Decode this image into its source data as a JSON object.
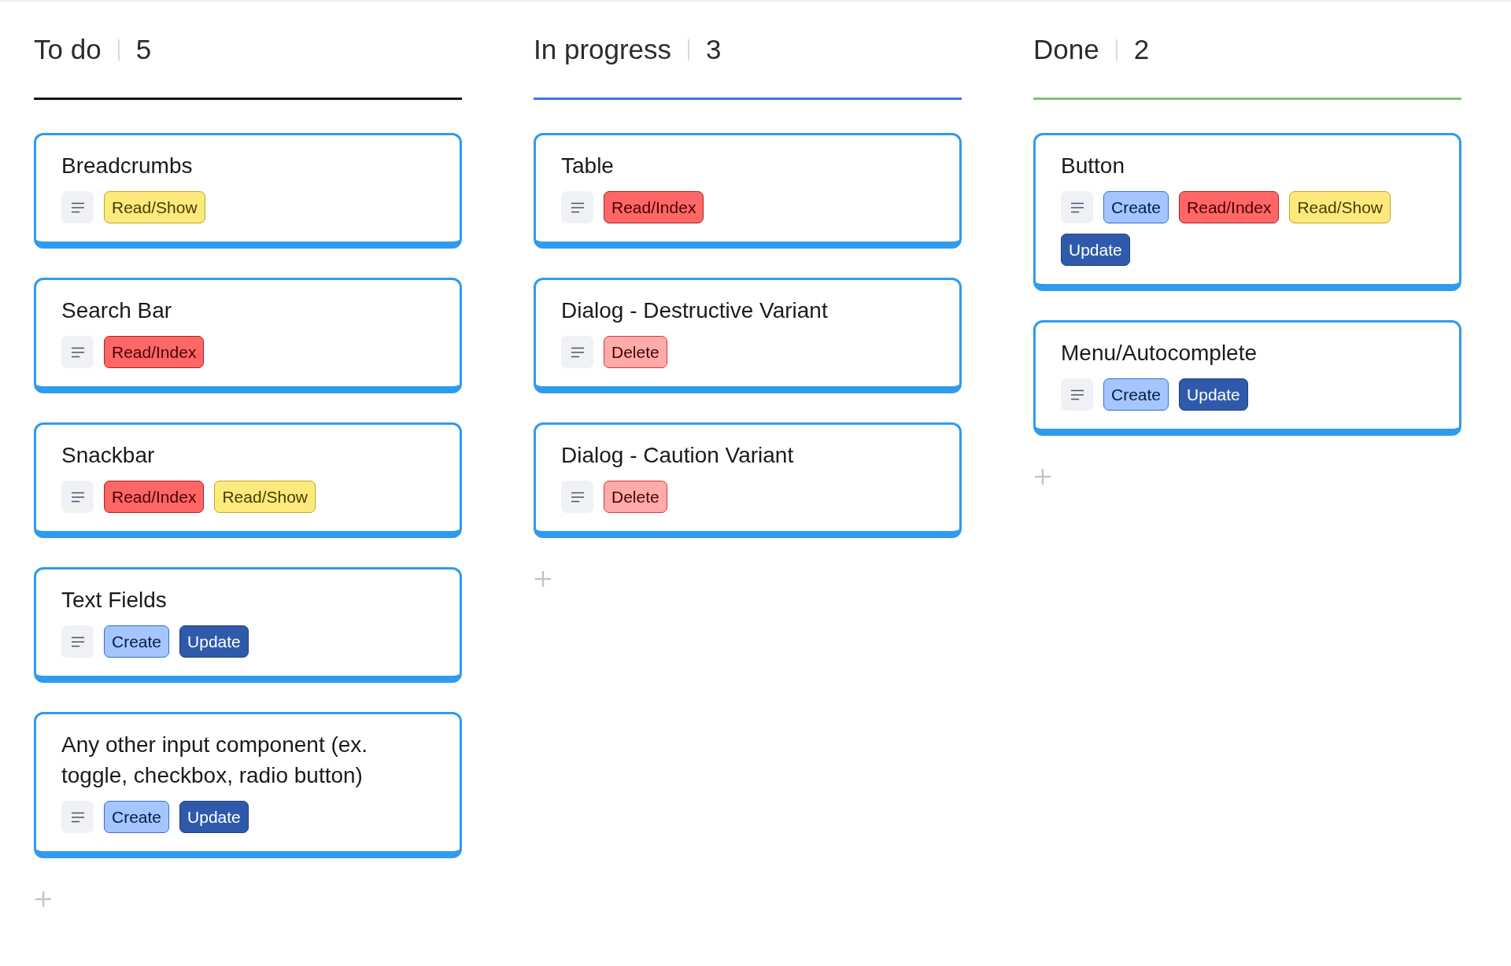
{
  "columns": [
    {
      "title": "To do",
      "count": "5",
      "color": "#111111",
      "cards": [
        {
          "title": "Breadcrumbs",
          "has_description": true,
          "tags": [
            {
              "label": "Read/Show",
              "color": "#feea7c"
            }
          ]
        },
        {
          "title": "Search Bar",
          "has_description": true,
          "tags": [
            {
              "label": "Read/Index",
              "color": "#ff6666"
            }
          ]
        },
        {
          "title": "Snackbar",
          "has_description": true,
          "tags": [
            {
              "label": "Read/Index",
              "color": "#ff6666"
            },
            {
              "label": "Read/Show",
              "color": "#feea7c"
            }
          ]
        },
        {
          "title": "Text Fields",
          "has_description": true,
          "tags": [
            {
              "label": "Create",
              "color": "#a4c5fd"
            },
            {
              "label": "Update",
              "color": "#2f5aab"
            }
          ]
        },
        {
          "title": "Any other input component (ex. toggle, checkbox, radio button)",
          "has_description": true,
          "tags": [
            {
              "label": "Create",
              "color": "#a4c5fd"
            },
            {
              "label": "Update",
              "color": "#2f5aab"
            }
          ]
        }
      ]
    },
    {
      "title": "In progress",
      "count": "3",
      "color": "#3a76e8",
      "cards": [
        {
          "title": "Table",
          "has_description": true,
          "tags": [
            {
              "label": "Read/Index",
              "color": "#ff6666"
            }
          ]
        },
        {
          "title": "Dialog - Destructive Variant",
          "has_description": true,
          "tags": [
            {
              "label": "Delete",
              "color": "#ffabab"
            }
          ]
        },
        {
          "title": "Dialog - Caution Variant",
          "has_description": true,
          "tags": [
            {
              "label": "Delete",
              "color": "#ffabab"
            }
          ]
        }
      ]
    },
    {
      "title": "Done",
      "count": "2",
      "color": "#7cc474",
      "cards": [
        {
          "title": "Button",
          "has_description": true,
          "tags": [
            {
              "label": "Create",
              "color": "#a4c5fd"
            },
            {
              "label": "Read/Index",
              "color": "#ff6666"
            },
            {
              "label": "Read/Show",
              "color": "#feea7c"
            },
            {
              "label": "Update",
              "color": "#2f5aab"
            }
          ]
        },
        {
          "title": "Menu/Autocomplete",
          "has_description": true,
          "tags": [
            {
              "label": "Create",
              "color": "#a4c5fd"
            },
            {
              "label": "Update",
              "color": "#2f5aab"
            }
          ]
        }
      ]
    }
  ]
}
